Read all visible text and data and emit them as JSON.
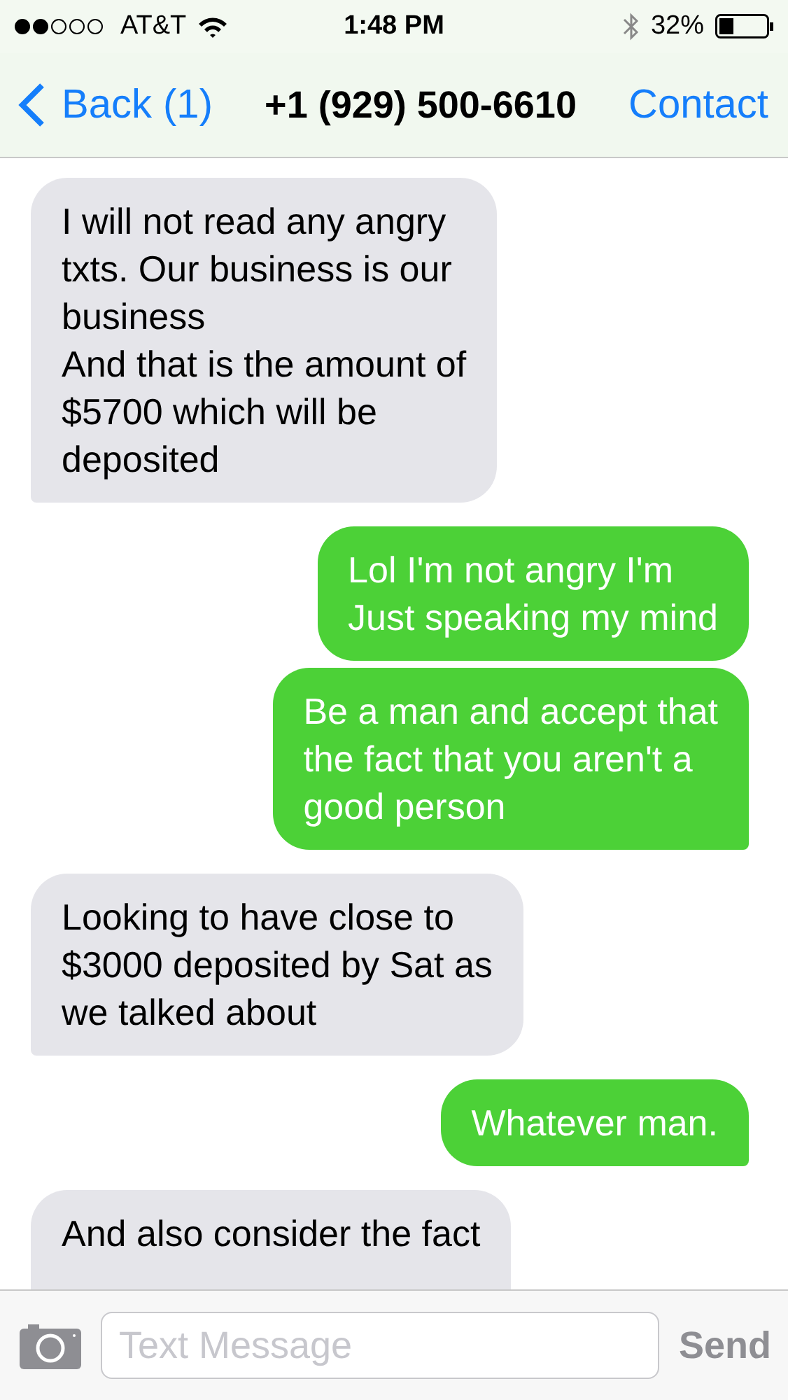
{
  "status_bar": {
    "carrier": "AT&T",
    "time": "1:48 PM",
    "battery": "32%"
  },
  "nav": {
    "back": "Back (1)",
    "title": "+1 (929) 500-6610",
    "action": "Contact"
  },
  "messages": [
    {
      "kind": "received",
      "text": "I will not read any angry\ntxts. Our business is our\nbusiness\nAnd that is the amount of\n$5700 which will be\ndeposited"
    },
    {
      "kind": "sent",
      "text": "Lol I'm not angry I'm\nJust speaking my mind"
    },
    {
      "kind": "sent",
      "text": "Be a man and accept that\nthe fact that you aren't a\ngood person"
    },
    {
      "kind": "received",
      "text": "Looking to have close to\n$3000 deposited by Sat as\nwe talked about"
    },
    {
      "kind": "sent",
      "text": "Whatever man."
    },
    {
      "kind": "received",
      "text": "And also consider the fact"
    }
  ],
  "composer": {
    "placeholder": "Text Message",
    "send": "Send"
  }
}
